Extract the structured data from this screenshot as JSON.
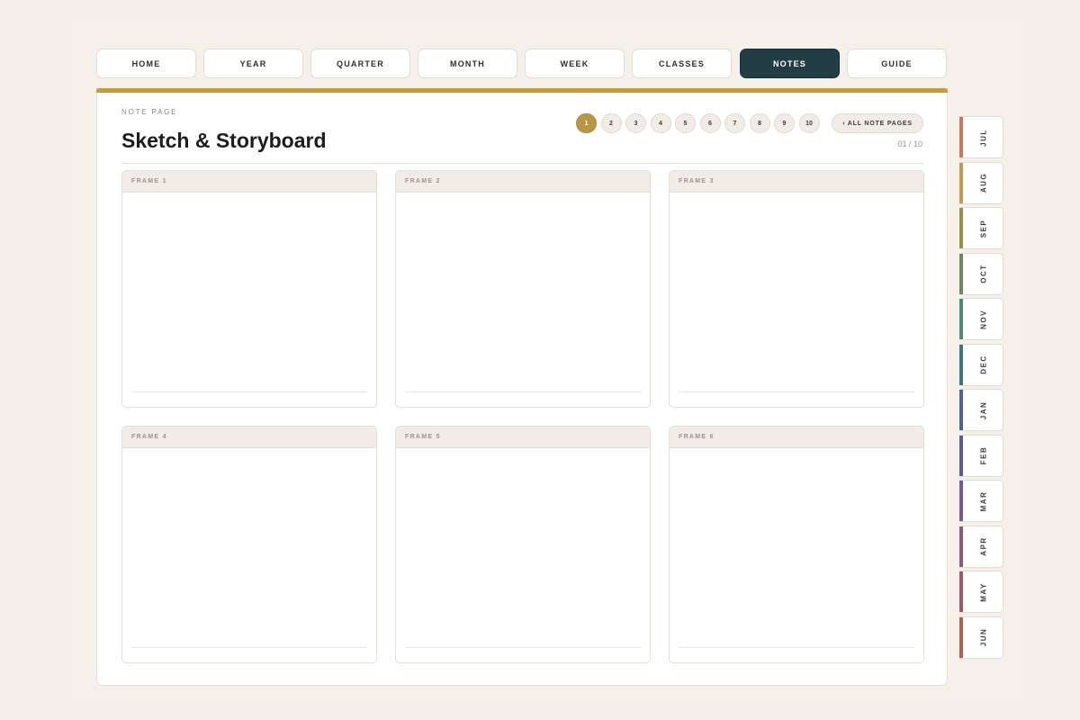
{
  "nav": {
    "items": [
      {
        "label": "HOME",
        "active": false
      },
      {
        "label": "YEAR",
        "active": false
      },
      {
        "label": "QUARTER",
        "active": false
      },
      {
        "label": "MONTH",
        "active": false
      },
      {
        "label": "WEEK",
        "active": false
      },
      {
        "label": "CLASSES",
        "active": false
      },
      {
        "label": "NOTES",
        "active": true
      },
      {
        "label": "GUIDE",
        "active": false
      }
    ]
  },
  "page": {
    "eyebrow": "NOTE PAGE",
    "title": "Sketch & Storyboard",
    "counter": "01 / 10",
    "all_pages_label": "‹ ALL NOTE PAGES",
    "pages": [
      "1",
      "2",
      "3",
      "4",
      "5",
      "6",
      "7",
      "8",
      "9",
      "10"
    ],
    "current_page": "1",
    "accent_color": "#c19a4c"
  },
  "frames": [
    {
      "label": "FRAME 1"
    },
    {
      "label": "FRAME 2"
    },
    {
      "label": "FRAME 3"
    },
    {
      "label": "FRAME 4"
    },
    {
      "label": "FRAME 5"
    },
    {
      "label": "FRAME 6"
    }
  ],
  "month_tabs": [
    {
      "label": "JUL",
      "color": "#c97a5a"
    },
    {
      "label": "AUG",
      "color": "#c49a4f"
    },
    {
      "label": "SEP",
      "color": "#949148"
    },
    {
      "label": "OCT",
      "color": "#6e8a5a"
    },
    {
      "label": "NOV",
      "color": "#4f8a76"
    },
    {
      "label": "DEC",
      "color": "#3f7480"
    },
    {
      "label": "JAN",
      "color": "#4a639a"
    },
    {
      "label": "FEB",
      "color": "#5d5b9c"
    },
    {
      "label": "MAR",
      "color": "#785a92"
    },
    {
      "label": "APR",
      "color": "#8f587d"
    },
    {
      "label": "MAY",
      "color": "#9f5868"
    },
    {
      "label": "JUN",
      "color": "#b1634f"
    }
  ]
}
